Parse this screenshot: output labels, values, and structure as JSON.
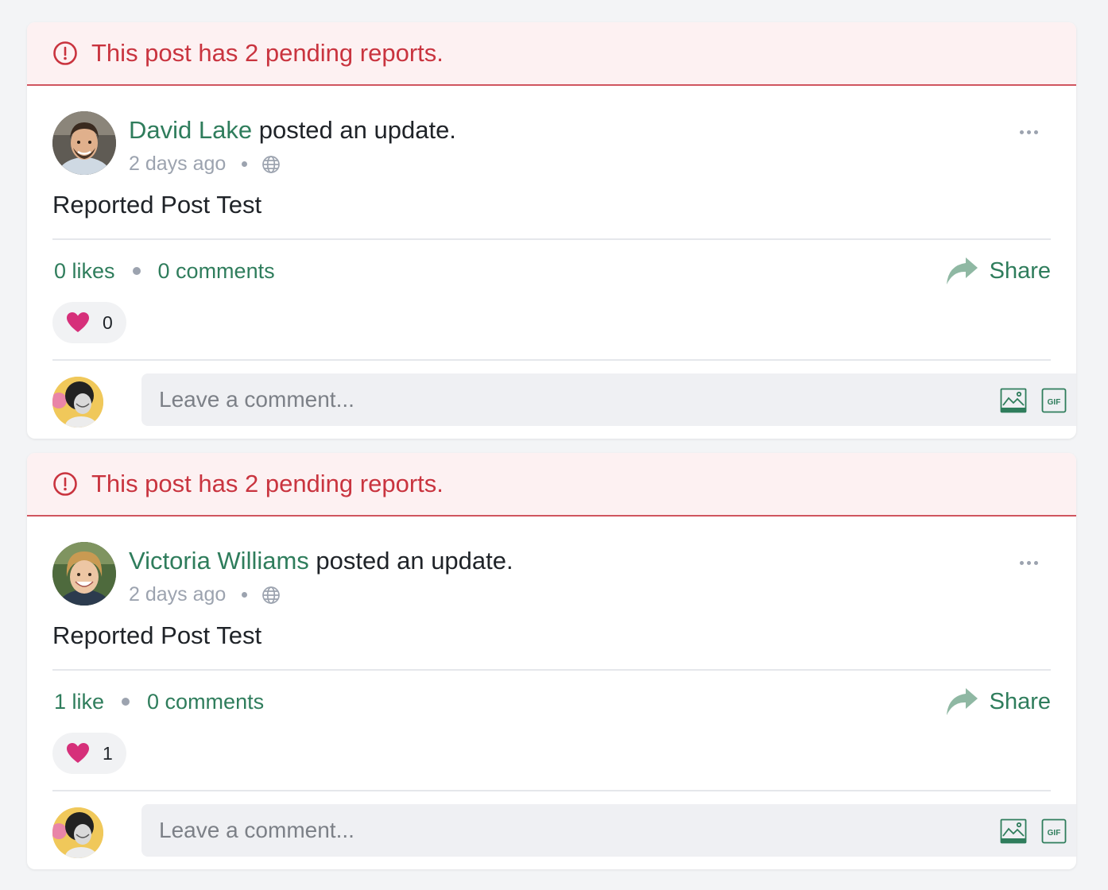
{
  "posts": [
    {
      "report_banner": "This post has 2 pending reports.",
      "author": "David Lake",
      "action": " posted an update.",
      "time": "2 days ago",
      "text": "Reported Post Test",
      "likes_label": "0 likes",
      "comments_label": "0 comments",
      "share_label": "Share",
      "reaction_count": "0",
      "comment_placeholder": "Leave a comment..."
    },
    {
      "report_banner": "This post has 2 pending reports.",
      "author": "Victoria Williams",
      "action": " posted an update.",
      "time": "2 days ago",
      "text": "Reported Post Test",
      "likes_label": "1 like",
      "comments_label": "0 comments",
      "share_label": "Share",
      "reaction_count": "1",
      "comment_placeholder": "Leave a comment..."
    }
  ],
  "colors": {
    "accent": "#2f7d5c",
    "alert": "#c9343f",
    "alert_bg": "#fdf1f2",
    "heart": "#d6307a"
  }
}
